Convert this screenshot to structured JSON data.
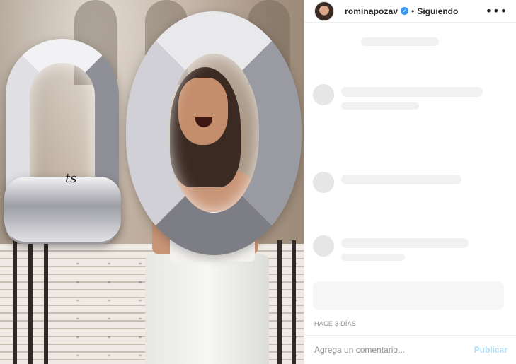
{
  "header": {
    "username": "rominapozav",
    "verified_symbol": "✓",
    "separator": "•",
    "follow_status": "Siguiendo",
    "more_symbol": "•••"
  },
  "photo": {
    "balloon_text": "ts"
  },
  "post": {
    "timestamp": "HACE 3 DÍAS"
  },
  "comment_box": {
    "placeholder": "Agrega un comentario...",
    "post_label": "Publicar"
  },
  "colors": {
    "verified_blue": "#3897f0",
    "publish_disabled": "#b2dffc",
    "muted_text": "#8e8e8e"
  },
  "icons": {
    "verified": "verified-badge-icon",
    "more": "more-options-icon"
  }
}
